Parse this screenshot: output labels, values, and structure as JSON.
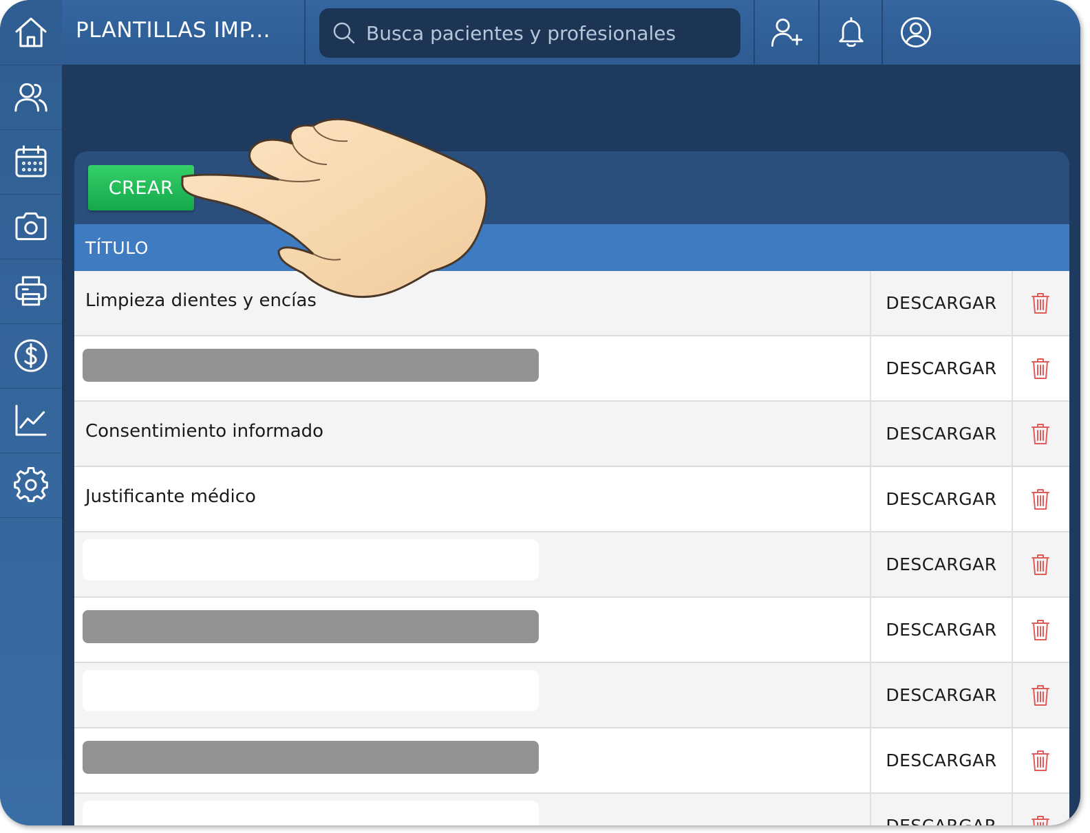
{
  "header": {
    "title": "PLANTILLAS IMP...",
    "search_placeholder": "Busca pacientes y profesionales",
    "icons": [
      "add-patient-icon",
      "bell-icon",
      "user-account-icon"
    ]
  },
  "sidebar": {
    "items": [
      {
        "icon": "home-icon"
      },
      {
        "icon": "patients-icon"
      },
      {
        "icon": "calendar-icon"
      },
      {
        "icon": "camera-icon"
      },
      {
        "icon": "printer-icon"
      },
      {
        "icon": "billing-icon"
      },
      {
        "icon": "stats-icon"
      },
      {
        "icon": "settings-icon"
      }
    ]
  },
  "toolbar": {
    "create_label": "CREAR"
  },
  "table": {
    "column_title": "TÍTULO",
    "rows": [
      {
        "title": "Limpieza dientes y encías",
        "action": "DESCARGAR"
      },
      {
        "title": "",
        "action": "DESCARGAR"
      },
      {
        "title": "Consentimiento informado",
        "action": "DESCARGAR"
      },
      {
        "title": "Justificante médico",
        "action": "DESCARGAR"
      },
      {
        "title": "",
        "action": "DESCARGAR"
      },
      {
        "title": "",
        "action": "DESCARGAR"
      },
      {
        "title": "",
        "action": "DESCARGAR"
      },
      {
        "title": "",
        "action": "DESCARGAR"
      },
      {
        "title": "",
        "action": "DESCARGAR"
      }
    ]
  },
  "colors": {
    "sidebar": "#2f5d91",
    "topbar": "#3566a0",
    "background": "#1e3a5e",
    "panel": "#2a4f7c",
    "table_header": "#3e7bc0",
    "create_button": "#1fb854",
    "delete_icon": "#e05a5a"
  }
}
